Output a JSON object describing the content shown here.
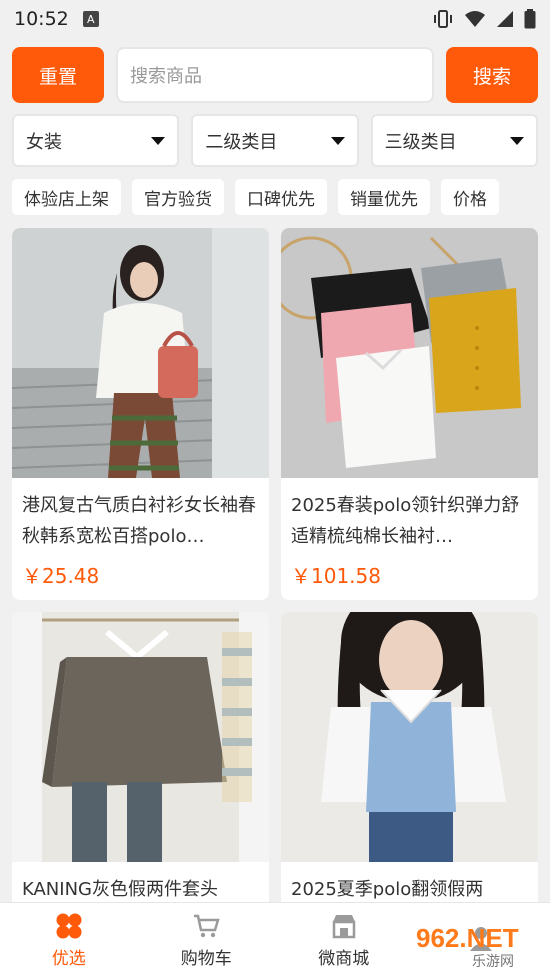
{
  "status": {
    "time": "10:52",
    "a_badge": "A"
  },
  "search": {
    "reset_label": "重置",
    "placeholder": "搜索商品",
    "search_label": "搜索"
  },
  "filters": {
    "category1": "女装",
    "category2": "二级类目",
    "category3": "三级类目"
  },
  "tags": [
    "体验店上架",
    "官方验货",
    "口碑优先",
    "销量优先",
    "价格"
  ],
  "products": [
    {
      "title": "港风复古气质白衬衫女长袖春秋韩系宽松百搭polo…",
      "price": "￥25.48"
    },
    {
      "title": "2025春装polo领针织弹力舒适精梳纯棉长袖衬…",
      "price": "￥101.58"
    },
    {
      "title": "KANING灰色假两件套头",
      "price": ""
    },
    {
      "title": "2025夏季polo翻领假两",
      "price": ""
    }
  ],
  "tabbar": [
    {
      "label": "优选",
      "icon": "four-petal-icon",
      "active": true
    },
    {
      "label": "购物车",
      "icon": "cart-icon",
      "active": false
    },
    {
      "label": "微商城",
      "icon": "store-icon",
      "active": false
    }
  ],
  "watermark": {
    "text": "962.NET",
    "sub": "乐游网"
  },
  "colors": {
    "accent": "#ff5a0a",
    "background": "#f0f0f0"
  }
}
